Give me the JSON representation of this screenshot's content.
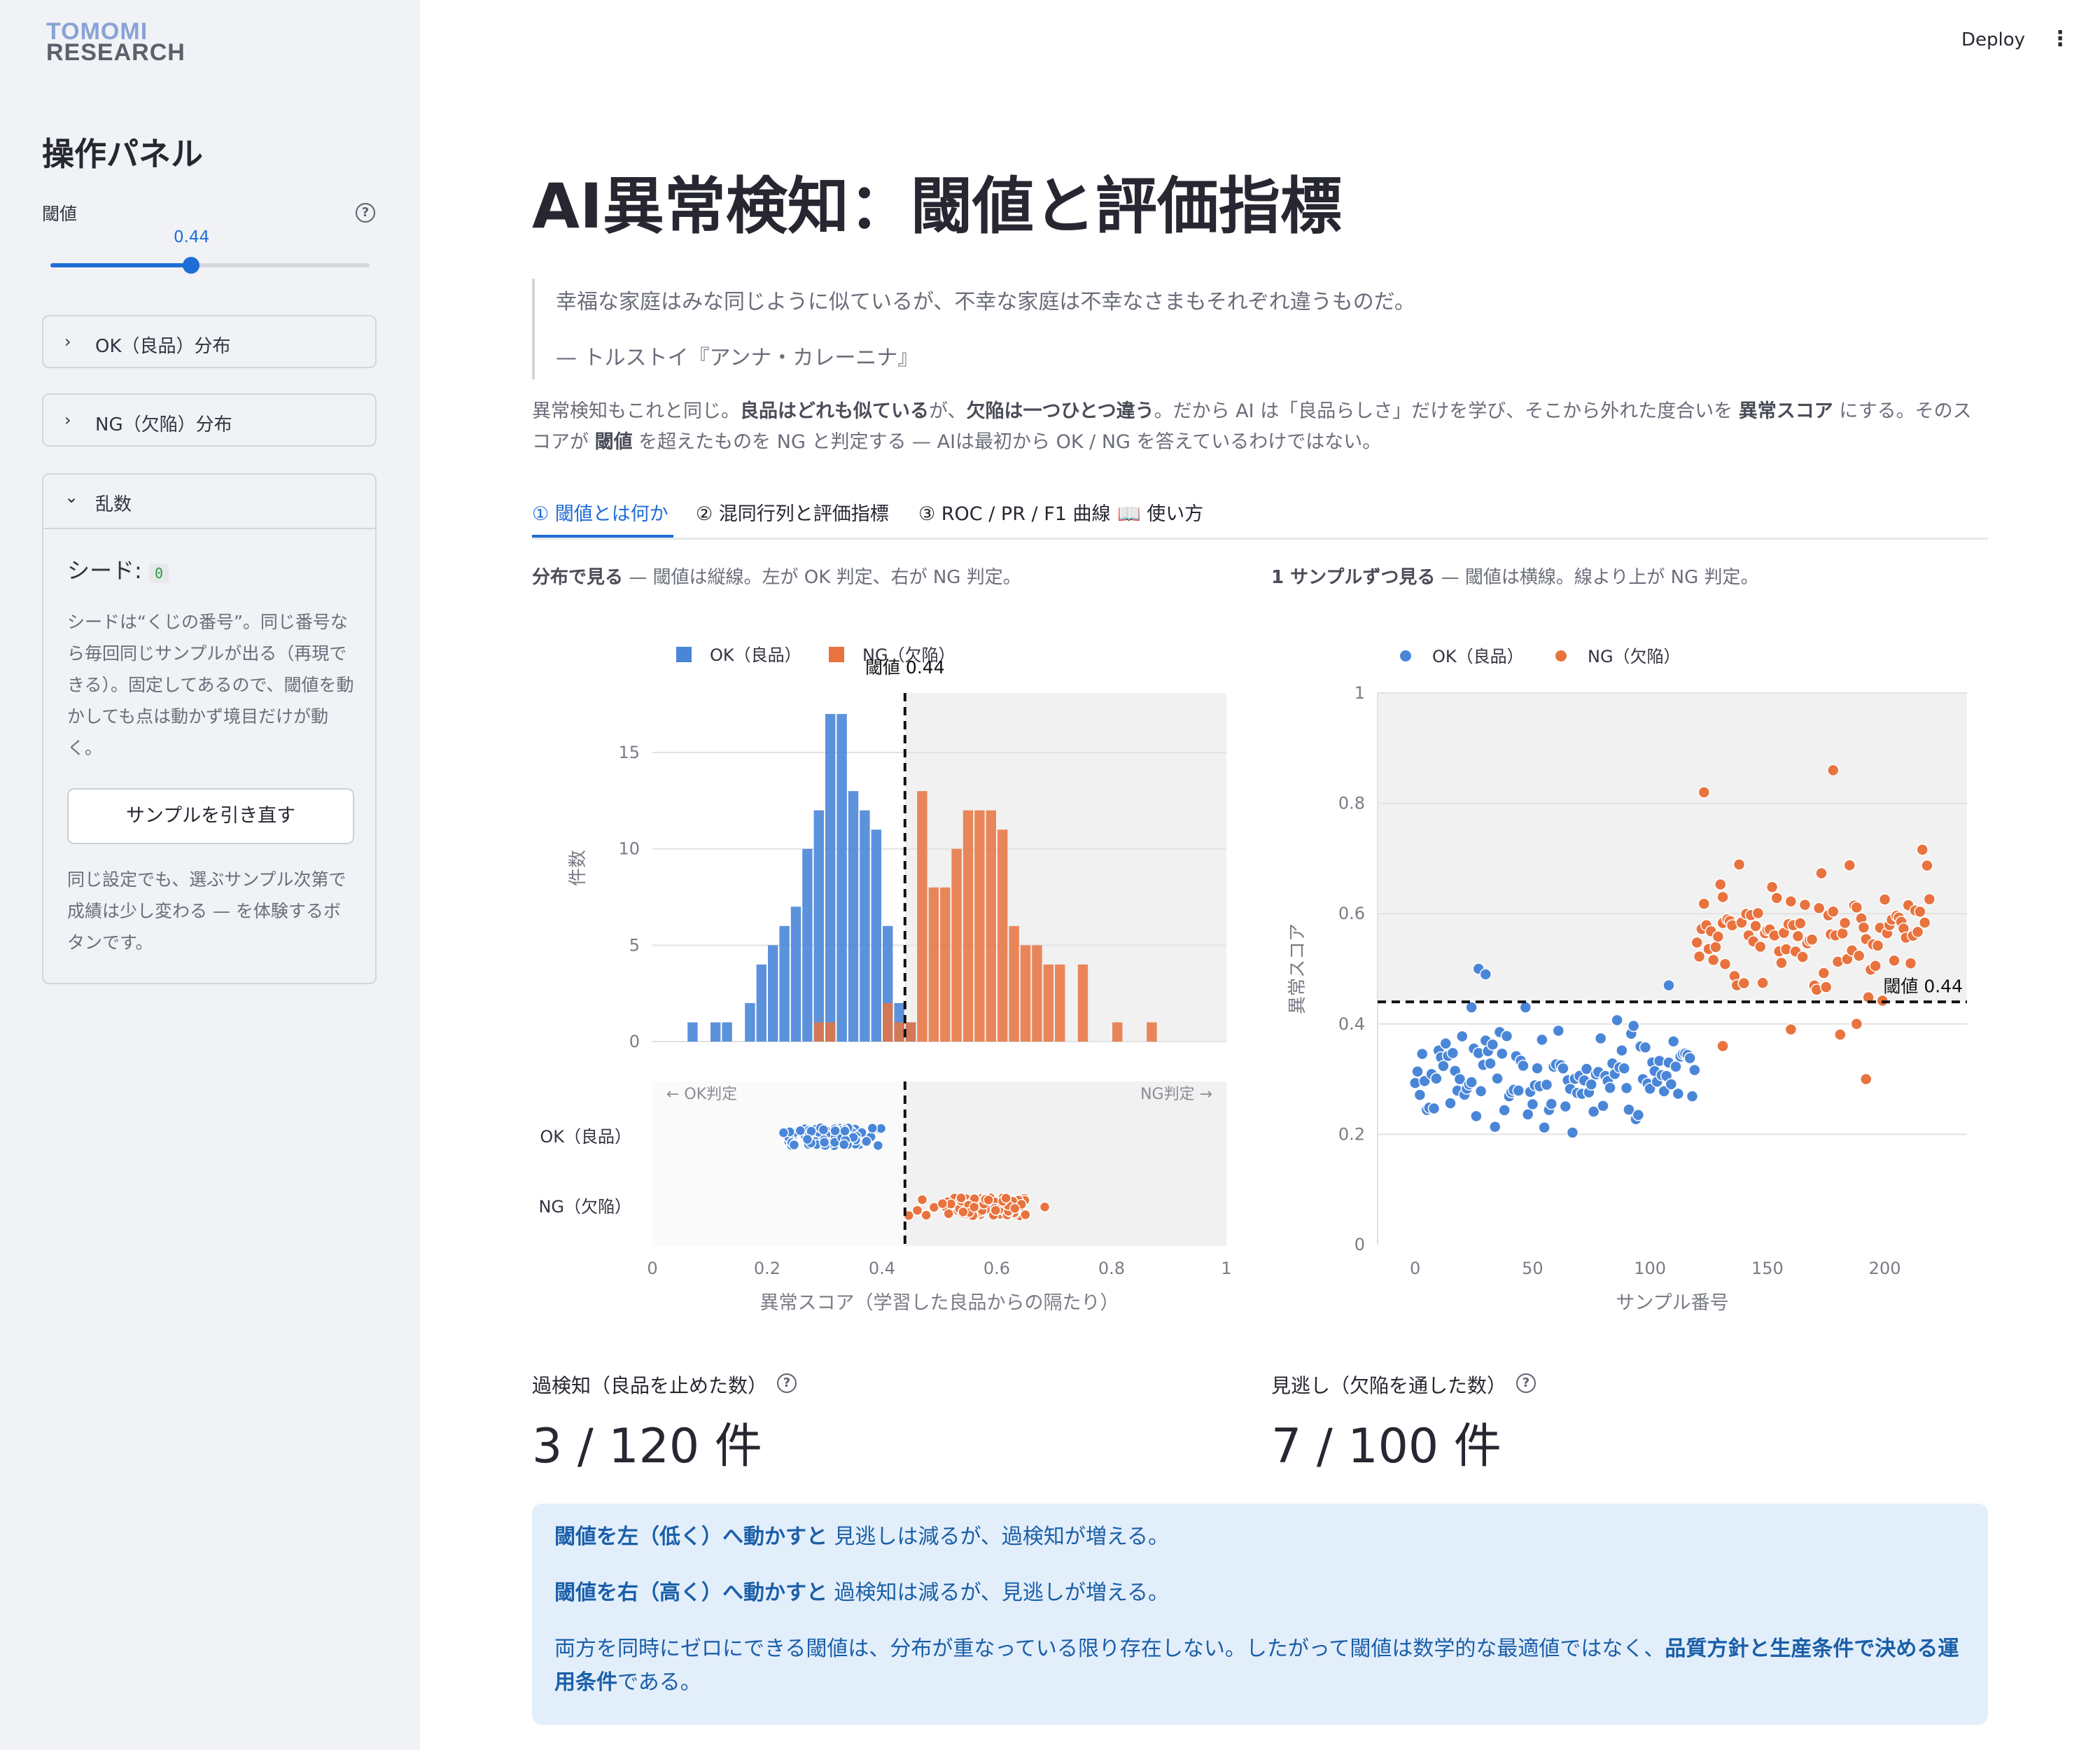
{
  "logo": {
    "line1": "TOMOMI",
    "line2": "RESEARCH"
  },
  "topbar": {
    "deploy": "Deploy",
    "menu": "⋮"
  },
  "sidebar": {
    "title": "操作パネル",
    "threshold_label": "閾値",
    "threshold_value": "0.44",
    "threshold_fraction": 0.44,
    "expanders": [
      {
        "label": "OK（良品）分布",
        "chevron": "›"
      },
      {
        "label": "NG（欠陥）分布",
        "chevron": "›"
      },
      {
        "label": "乱数",
        "chevron": "⌄"
      }
    ],
    "seed_label": "シード:",
    "seed_value": "0",
    "seed_help": "シードは“くじの番号”。同じ番号なら毎回同じサンプルが出る（再現できる）。固定してあるので、閾値を動かしても点は動かず境目だけが動く。",
    "redraw_button": "サンプルを引き直す",
    "redraw_help": "同じ設定でも、選ぶサンプル次第で成績は少し変わる — を体験するボタンです。"
  },
  "main": {
    "title": "AI異常検知：閾値と評価指標",
    "quote": "幸福な家庭はみな同じように似ているが、不幸な家庭は不幸なさまもそれぞれ違うものだ。",
    "quote_source": "— トルストイ『アンナ・カレーニナ』",
    "intro_parts": [
      "異常検知もこれと同じ。",
      "良品はどれも似ている",
      "が、",
      "欠陥は一つひとつ違う",
      "。だから AI は「良品らしさ」だけを学び、そこから外れた度合いを ",
      "異常スコア",
      " にする。そのスコアが ",
      "閾値",
      " を超えたものを NG と判定する — AIは最初から OK / NG を答えているわけではない。"
    ],
    "tabs": [
      "① 閾値とは何か",
      "② 混同行列と評価指標",
      "③ ROC / PR / F1 曲線",
      "📖 使い方"
    ],
    "left_caption_bold": "分布で見る",
    "left_caption": " — 閾値は縦線。左が OK 判定、右が NG 判定。",
    "right_caption_bold": "1 サンプルずつ見る",
    "right_caption": " — 閾値は横線。線より上が NG 判定。",
    "metrics": [
      {
        "label": "過検知（良品を止めた数）",
        "value": "3 / 120 件"
      },
      {
        "label": "見逃し（欠陥を通した数）",
        "value": "7 / 100 件"
      }
    ],
    "info": {
      "p1_bold": "閾値を左（低く）へ動かすと",
      "p1": " 見逃しは減るが、過検知が増える。",
      "p2_bold": "閾値を右（高く）へ動かすと",
      "p2": " 過検知は減るが、見逃しが増える。",
      "p3": "両方を同時にゼロにできる閾値は、分布が重なっている限り存在しない。したがって閾値は数学的な最適値ではなく、",
      "p3_bold": "品質方針と生産条件で決める運用条件",
      "p3_end": "である。"
    }
  },
  "chart_data": [
    {
      "type": "bar",
      "legend": [
        "OK（良品）",
        "NG（欠陥）"
      ],
      "threshold": 0.44,
      "threshold_label": "閾値 0.44",
      "xlabel": "異常スコア（学習した良品からの隔たり）",
      "ylabel": "件数",
      "xlim": [
        0,
        1
      ],
      "ylim": [
        0,
        17
      ],
      "xticks": [
        "0",
        "0.2",
        "0.4",
        "0.6",
        "0.8",
        "1"
      ],
      "yticks": [
        "0",
        "5",
        "10",
        "15"
      ],
      "bin_width": 0.02,
      "series": [
        {
          "name": "OK（良品）",
          "color": "#4a86d8",
          "bins": [
            [
              0.06,
              1
            ],
            [
              0.1,
              1
            ],
            [
              0.12,
              1
            ],
            [
              0.16,
              2
            ],
            [
              0.18,
              4
            ],
            [
              0.2,
              5
            ],
            [
              0.22,
              6
            ],
            [
              0.24,
              7
            ],
            [
              0.26,
              10
            ],
            [
              0.28,
              12
            ],
            [
              0.3,
              17
            ],
            [
              0.32,
              17
            ],
            [
              0.34,
              13
            ],
            [
              0.36,
              12
            ],
            [
              0.38,
              11
            ],
            [
              0.4,
              6
            ],
            [
              0.42,
              2
            ],
            [
              0.44,
              1
            ]
          ]
        },
        {
          "name": "NG（欠陥）",
          "color": "#e8733e",
          "bins": [
            [
              0.28,
              1
            ],
            [
              0.3,
              1
            ],
            [
              0.4,
              2
            ],
            [
              0.42,
              1
            ],
            [
              0.44,
              1
            ],
            [
              0.46,
              13
            ],
            [
              0.48,
              8
            ],
            [
              0.5,
              8
            ],
            [
              0.52,
              10
            ],
            [
              0.54,
              12
            ],
            [
              0.56,
              12
            ],
            [
              0.58,
              12
            ],
            [
              0.6,
              11
            ],
            [
              0.62,
              6
            ],
            [
              0.64,
              5
            ],
            [
              0.66,
              5
            ],
            [
              0.68,
              4
            ],
            [
              0.7,
              4
            ],
            [
              0.74,
              4
            ],
            [
              0.8,
              1
            ],
            [
              0.86,
              1
            ]
          ]
        }
      ],
      "strip": {
        "rows": [
          "OK（良品）",
          "NG（欠陥）"
        ],
        "left_note": "← OK判定",
        "right_note": "NG判定 →",
        "ok_range": [
          0.07,
          0.5
        ],
        "ng_range": [
          0.3,
          0.86
        ]
      }
    },
    {
      "type": "scatter",
      "legend": [
        "OK（良品）",
        "NG（欠陥）"
      ],
      "threshold": 0.44,
      "threshold_label": "閾値 0.44",
      "xlabel": "サンプル番号",
      "ylabel": "異常スコア",
      "xlim": [
        -16,
        235
      ],
      "ylim": [
        0,
        1
      ],
      "xticks": [
        "0",
        "50",
        "100",
        "150",
        "200"
      ],
      "yticks": [
        "0",
        "0.2",
        "0.4",
        "0.6",
        "0.8",
        "1"
      ],
      "ok_count": 120,
      "ng_count": 100,
      "ok_center": 0.31,
      "ng_center": 0.56,
      "ok_extra_points": [
        [
          27,
          0.5
        ],
        [
          30,
          0.49
        ],
        [
          24,
          0.43
        ],
        [
          108,
          0.47
        ]
      ],
      "ng_extra_points": [
        [
          123,
          0.82
        ],
        [
          131,
          0.63
        ],
        [
          178,
          0.86
        ],
        [
          131,
          0.36
        ],
        [
          192,
          0.3
        ],
        [
          160,
          0.39
        ],
        [
          188,
          0.4
        ]
      ]
    }
  ]
}
